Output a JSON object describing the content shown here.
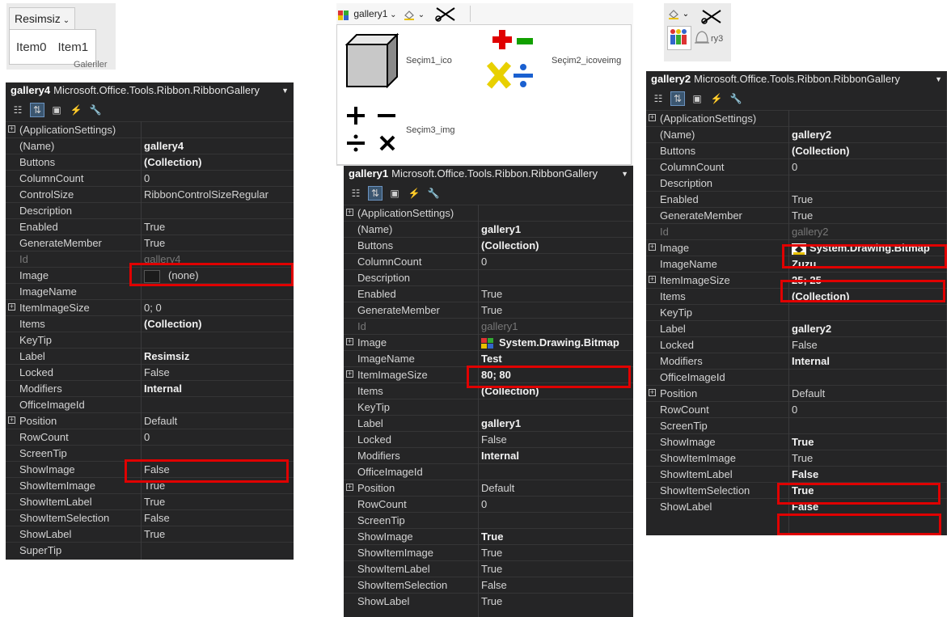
{
  "ribbon_a": {
    "dropdown_label": "Resimsiz",
    "items": [
      "Item0",
      "Item1"
    ],
    "group_label": "Galeriler"
  },
  "ribbon_b": {
    "dropdown_label": "gallery1",
    "gallery_items": [
      "Seçim1_ico",
      "Seçim2_icoveimg",
      "Seçim3_img"
    ]
  },
  "ribbon_c": {
    "item_label_fragment": "ry3"
  },
  "grid4": {
    "object_name": "gallery4",
    "object_type": "Microsoft.Office.Tools.Ribbon.RibbonGallery",
    "rows": [
      {
        "name": "(ApplicationSettings)",
        "value": "",
        "expand": true
      },
      {
        "name": "(Name)",
        "value": "gallery4",
        "bold": true
      },
      {
        "name": "Buttons",
        "value": "(Collection)",
        "bold": true
      },
      {
        "name": "ColumnCount",
        "value": "0"
      },
      {
        "name": "ControlSize",
        "value": "RibbonControlSizeRegular"
      },
      {
        "name": "Description",
        "value": ""
      },
      {
        "name": "Enabled",
        "value": "True"
      },
      {
        "name": "GenerateMember",
        "value": "True"
      },
      {
        "name": "Id",
        "value": "gallery4",
        "dim": true
      },
      {
        "name": "Image",
        "value": "(none)",
        "swatch": "none"
      },
      {
        "name": "ImageName",
        "value": ""
      },
      {
        "name": "ItemImageSize",
        "value": "0; 0",
        "expand": true
      },
      {
        "name": "Items",
        "value": "(Collection)",
        "bold": true
      },
      {
        "name": "KeyTip",
        "value": ""
      },
      {
        "name": "Label",
        "value": "Resimsiz",
        "bold": true
      },
      {
        "name": "Locked",
        "value": "False"
      },
      {
        "name": "Modifiers",
        "value": "Internal",
        "bold": true
      },
      {
        "name": "OfficeImageId",
        "value": ""
      },
      {
        "name": "Position",
        "value": "Default",
        "expand": true
      },
      {
        "name": "RowCount",
        "value": "0"
      },
      {
        "name": "ScreenTip",
        "value": ""
      },
      {
        "name": "ShowImage",
        "value": "False"
      },
      {
        "name": "ShowItemImage",
        "value": "True"
      },
      {
        "name": "ShowItemLabel",
        "value": "True"
      },
      {
        "name": "ShowItemSelection",
        "value": "False"
      },
      {
        "name": "ShowLabel",
        "value": "True"
      },
      {
        "name": "SuperTip",
        "value": ""
      }
    ]
  },
  "grid1": {
    "object_name": "gallery1",
    "object_type": "Microsoft.Office.Tools.Ribbon.RibbonGallery",
    "rows": [
      {
        "name": "(ApplicationSettings)",
        "value": "",
        "expand": true
      },
      {
        "name": "(Name)",
        "value": "gallery1",
        "bold": true
      },
      {
        "name": "Buttons",
        "value": "(Collection)",
        "bold": true
      },
      {
        "name": "ColumnCount",
        "value": "0"
      },
      {
        "name": "Description",
        "value": ""
      },
      {
        "name": "Enabled",
        "value": "True"
      },
      {
        "name": "GenerateMember",
        "value": "True"
      },
      {
        "name": "Id",
        "value": "gallery1",
        "dim": true
      },
      {
        "name": "Image",
        "value": "System.Drawing.Bitmap",
        "bold": true,
        "expand": true,
        "swatch": "bitmap"
      },
      {
        "name": "ImageName",
        "value": "Test",
        "bold": true
      },
      {
        "name": "ItemImageSize",
        "value": "80; 80",
        "bold": true,
        "expand": true
      },
      {
        "name": "Items",
        "value": "(Collection)",
        "bold": true
      },
      {
        "name": "KeyTip",
        "value": ""
      },
      {
        "name": "Label",
        "value": "gallery1",
        "bold": true
      },
      {
        "name": "Locked",
        "value": "False"
      },
      {
        "name": "Modifiers",
        "value": "Internal",
        "bold": true
      },
      {
        "name": "OfficeImageId",
        "value": ""
      },
      {
        "name": "Position",
        "value": "Default",
        "expand": true
      },
      {
        "name": "RowCount",
        "value": "0"
      },
      {
        "name": "ScreenTip",
        "value": ""
      },
      {
        "name": "ShowImage",
        "value": "True",
        "bold": true
      },
      {
        "name": "ShowItemImage",
        "value": "True"
      },
      {
        "name": "ShowItemLabel",
        "value": "True"
      },
      {
        "name": "ShowItemSelection",
        "value": "False"
      },
      {
        "name": "ShowLabel",
        "value": "True"
      }
    ]
  },
  "grid2": {
    "object_name": "gallery2",
    "object_type": "Microsoft.Office.Tools.Ribbon.RibbonGallery",
    "rows": [
      {
        "name": "(ApplicationSettings)",
        "value": "",
        "expand": true
      },
      {
        "name": "(Name)",
        "value": "gallery2",
        "bold": true
      },
      {
        "name": "Buttons",
        "value": "(Collection)",
        "bold": true
      },
      {
        "name": "ColumnCount",
        "value": "0"
      },
      {
        "name": "Description",
        "value": ""
      },
      {
        "name": "Enabled",
        "value": "True"
      },
      {
        "name": "GenerateMember",
        "value": "True"
      },
      {
        "name": "Id",
        "value": "gallery2",
        "dim": true
      },
      {
        "name": "Image",
        "value": "System.Drawing.Bitmap",
        "bold": true,
        "expand": true,
        "swatch": "bitmap2"
      },
      {
        "name": "ImageName",
        "value": "Zuzu",
        "bold": true
      },
      {
        "name": "ItemImageSize",
        "value": "25; 25",
        "bold": true,
        "expand": true
      },
      {
        "name": "Items",
        "value": "(Collection)",
        "bold": true
      },
      {
        "name": "KeyTip",
        "value": ""
      },
      {
        "name": "Label",
        "value": "gallery2",
        "bold": true
      },
      {
        "name": "Locked",
        "value": "False"
      },
      {
        "name": "Modifiers",
        "value": "Internal",
        "bold": true
      },
      {
        "name": "OfficeImageId",
        "value": ""
      },
      {
        "name": "Position",
        "value": "Default",
        "expand": true
      },
      {
        "name": "RowCount",
        "value": "0"
      },
      {
        "name": "ScreenTip",
        "value": ""
      },
      {
        "name": "ShowImage",
        "value": "True",
        "bold": true
      },
      {
        "name": "ShowItemImage",
        "value": "True"
      },
      {
        "name": "ShowItemLabel",
        "value": "False",
        "bold": true
      },
      {
        "name": "ShowItemSelection",
        "value": "True",
        "bold": true
      },
      {
        "name": "ShowLabel",
        "value": "False",
        "bold": true
      }
    ]
  },
  "colors": {
    "grid_bg": "#252526",
    "highlight": "#e00000",
    "ribbon_bg": "#ebebeb"
  }
}
